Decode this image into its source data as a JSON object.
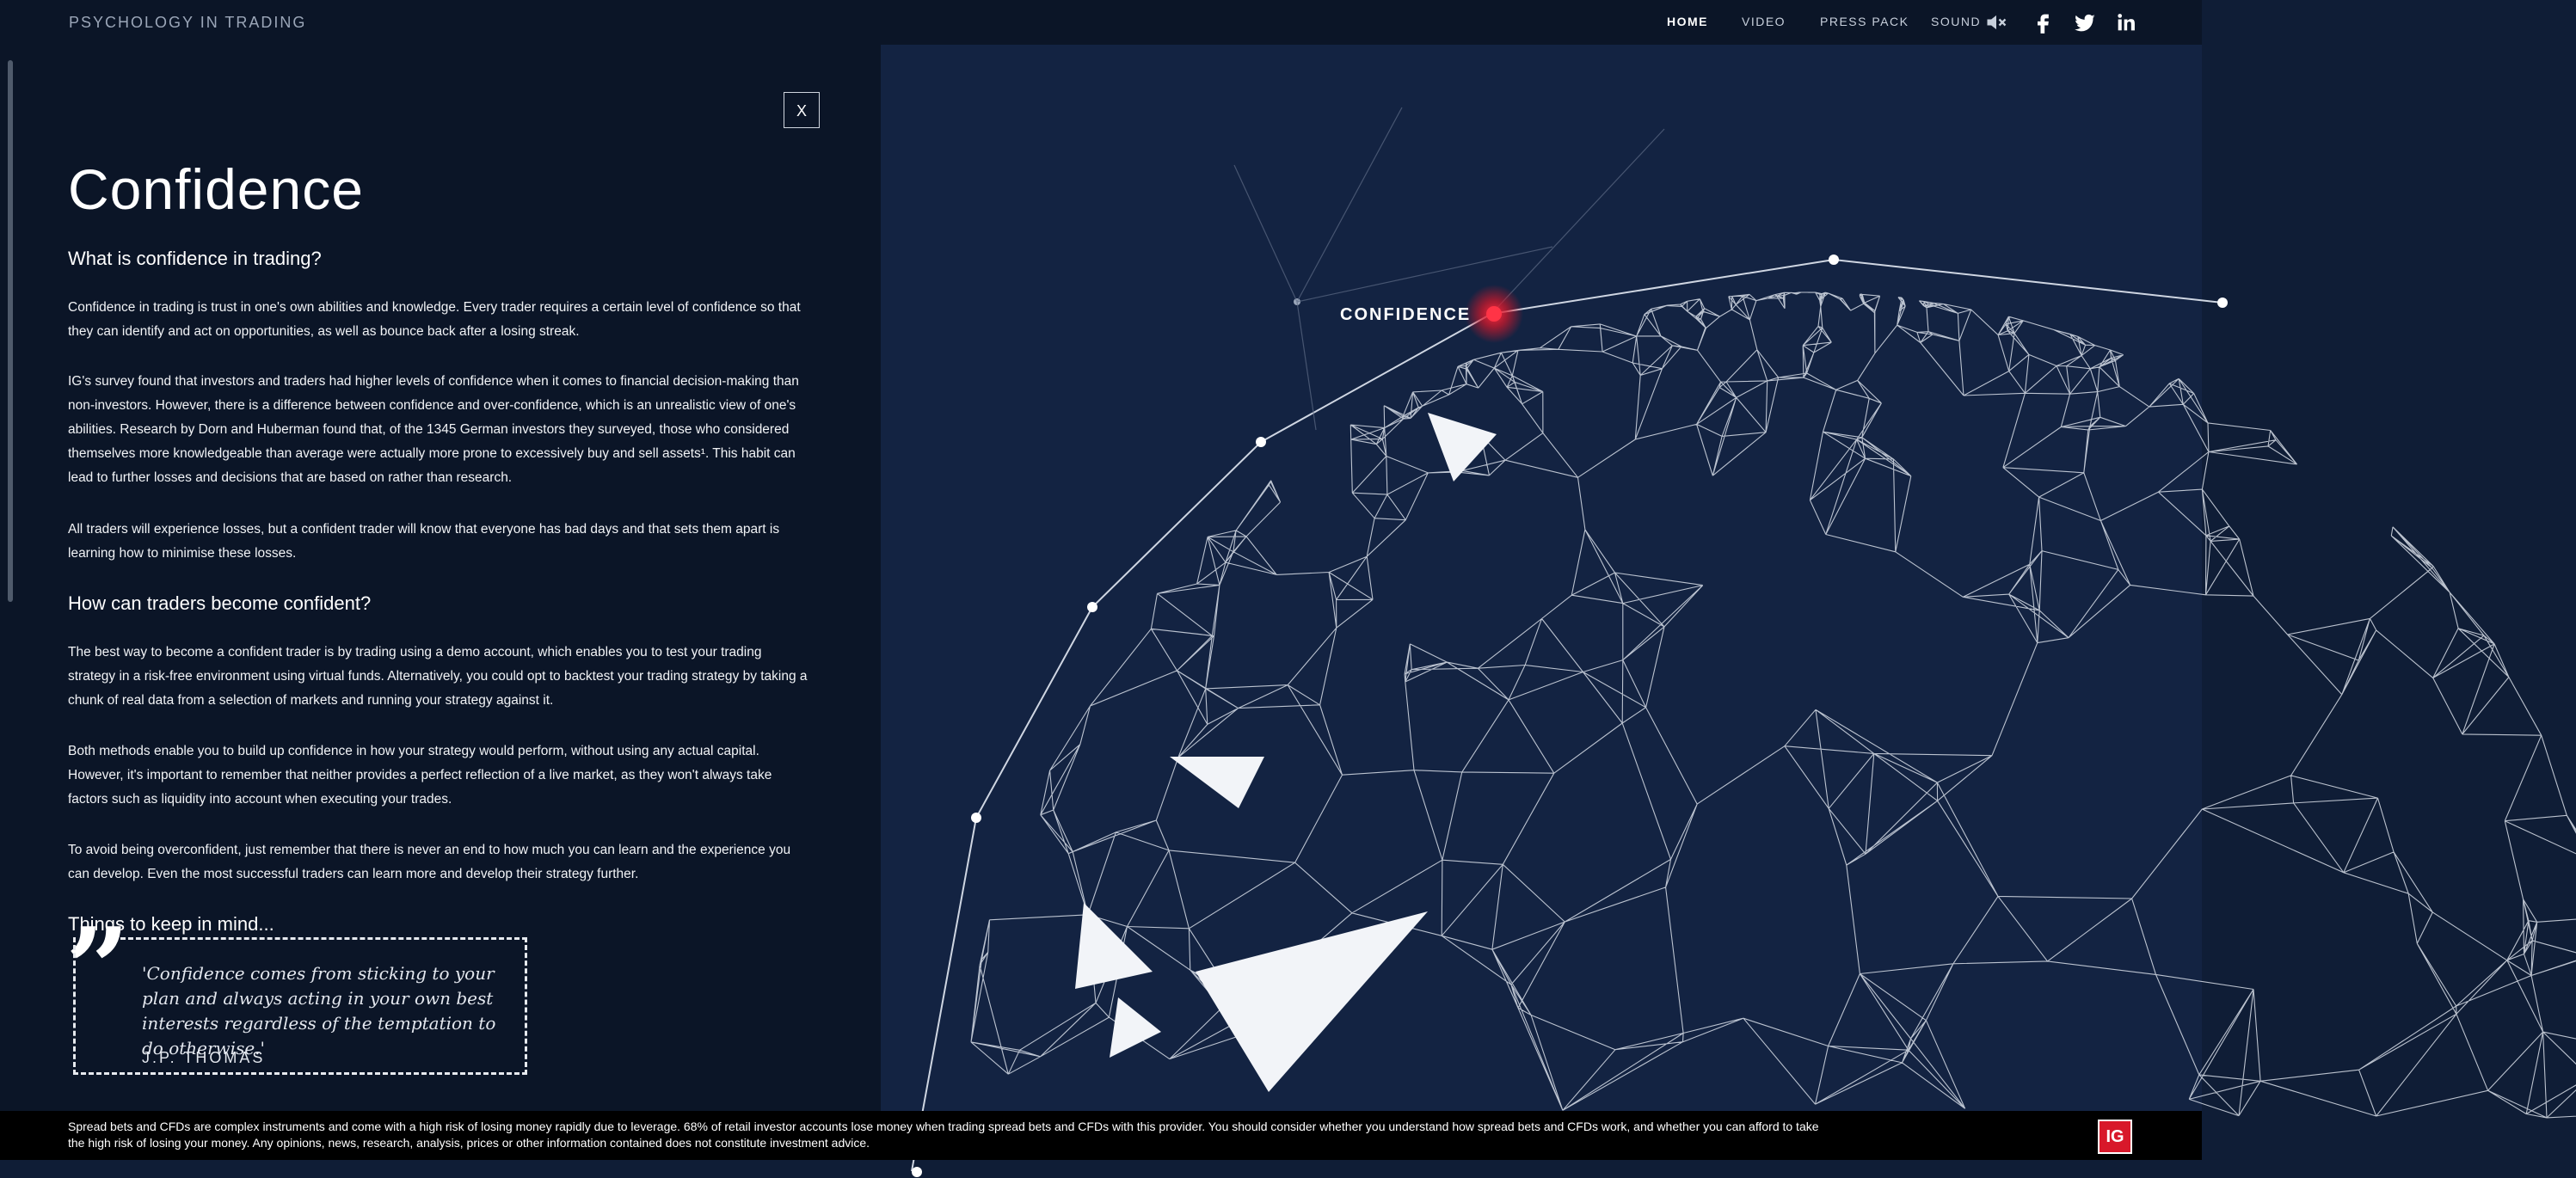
{
  "header": {
    "brand": "PSYCHOLOGY IN TRADING",
    "nav": {
      "home": "HOME",
      "video": "VIDEO",
      "press_pack": "PRESS PACK",
      "sound": "SOUND"
    },
    "icons": [
      "sound-muted-icon",
      "facebook-icon",
      "twitter-icon",
      "linkedin-icon"
    ]
  },
  "article": {
    "close_label": "X",
    "title": "Confidence",
    "section1_heading": "What is confidence in trading?",
    "p1": "Confidence in trading is trust in one's own abilities and knowledge. Every trader requires a certain level of confidence so that they can identify and act on opportunities, as well as bounce back after a losing streak.",
    "p2": "IG's survey found that investors and traders had higher levels of confidence when it comes to financial decision-making than non-investors. However, there is a difference between confidence and over-confidence, which is an unrealistic view of one's abilities. Research by Dorn and Huberman found that, of the 1345 German investors they surveyed, those who considered themselves more knowledgeable than average were actually more prone to excessively buy and sell assets¹. This habit can lead to further losses and decisions that are based on       rather than research.",
    "p3": "All traders will experience losses, but a confident trader will know that everyone has bad days and that sets them apart is learning how to minimise these losses.",
    "section2_heading": "How can traders become confident?",
    "p4": "The best way to become a confident trader is by trading using a demo account, which enables you to test your trading strategy in a risk-free environment using virtual funds. Alternatively, you could opt to backtest your trading strategy by taking a chunk of real data from a selection of markets and running your strategy against it.",
    "p5": "Both methods enable you to build up confidence in how your strategy would perform, without using any actual capital. However, it's important to remember that neither provides a perfect reflection of a live market, as they won't always take factors such as liquidity into account when executing your trades.",
    "p6": "To avoid being overconfident, just remember that there is never an end to how much you can learn and the experience you can develop. Even the most successful traders can learn more and develop their strategy further.",
    "section3_heading": "Things to keep in mind...",
    "quote_text": "'Confidence comes from sticking to your plan and always acting in your own best interests regardless of the temptation to do otherwise.'",
    "quote_author": "J.P. THOMAS"
  },
  "visual": {
    "node_label": "CONFIDENCE",
    "accent_color": "#d8182a"
  },
  "footer": {
    "disclaimer": "Spread bets and CFDs are complex instruments and come with a high risk of losing money rapidly due to leverage. 68% of retail investor accounts lose money when trading spread bets and CFDs with this provider. You should consider whether you understand how spread bets and CFDs work, and whether you can afford to take the high risk of losing your money. Any opinions, news, research, analysis, prices or other information contained does not constitute investment advice.",
    "logo_text": "IG"
  }
}
